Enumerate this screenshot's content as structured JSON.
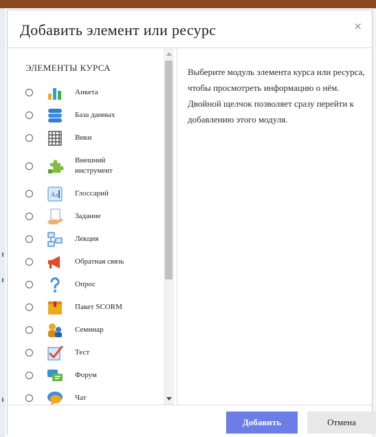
{
  "dialog": {
    "title": "Добавить элемент или ресурс",
    "close_symbol": "×"
  },
  "modules": {
    "section_label": "ЭЛЕМЕНТЫ КУРСА",
    "items": [
      {
        "label": "Анкета",
        "icon": "bar-chart-icon"
      },
      {
        "label": "База данных",
        "icon": "database-icon"
      },
      {
        "label": "Вики",
        "icon": "wiki-icon"
      },
      {
        "label_line1": "Внешний",
        "label_line2": "инструмент",
        "icon": "puzzle-icon"
      },
      {
        "label": "Глоссарий",
        "icon": "glossary-icon"
      },
      {
        "label": "Задание",
        "icon": "assignment-icon"
      },
      {
        "label": "Лекция",
        "icon": "lesson-icon"
      },
      {
        "label": "Обратная связь",
        "icon": "megaphone-icon"
      },
      {
        "label": "Опрос",
        "icon": "question-icon"
      },
      {
        "label": "Пакет SCORM",
        "icon": "package-icon"
      },
      {
        "label": "Семинар",
        "icon": "workshop-icon"
      },
      {
        "label": "Тест",
        "icon": "quiz-checkmark-icon"
      },
      {
        "label": "Форум",
        "icon": "forum-icon"
      },
      {
        "label": "Чат",
        "icon": "chat-icon"
      }
    ]
  },
  "help": {
    "text": "Выберите модуль элемента курса или ресурса, чтобы просмотреть информацию о нём. Двойной щелчок позволяет сразу перейти к добавлению этого модуля."
  },
  "footer": {
    "add_label": "Добавить",
    "cancel_label": "Отмена"
  },
  "colors": {
    "primary_button": "#6b7ee8",
    "top_bar": "#8a4a21"
  }
}
